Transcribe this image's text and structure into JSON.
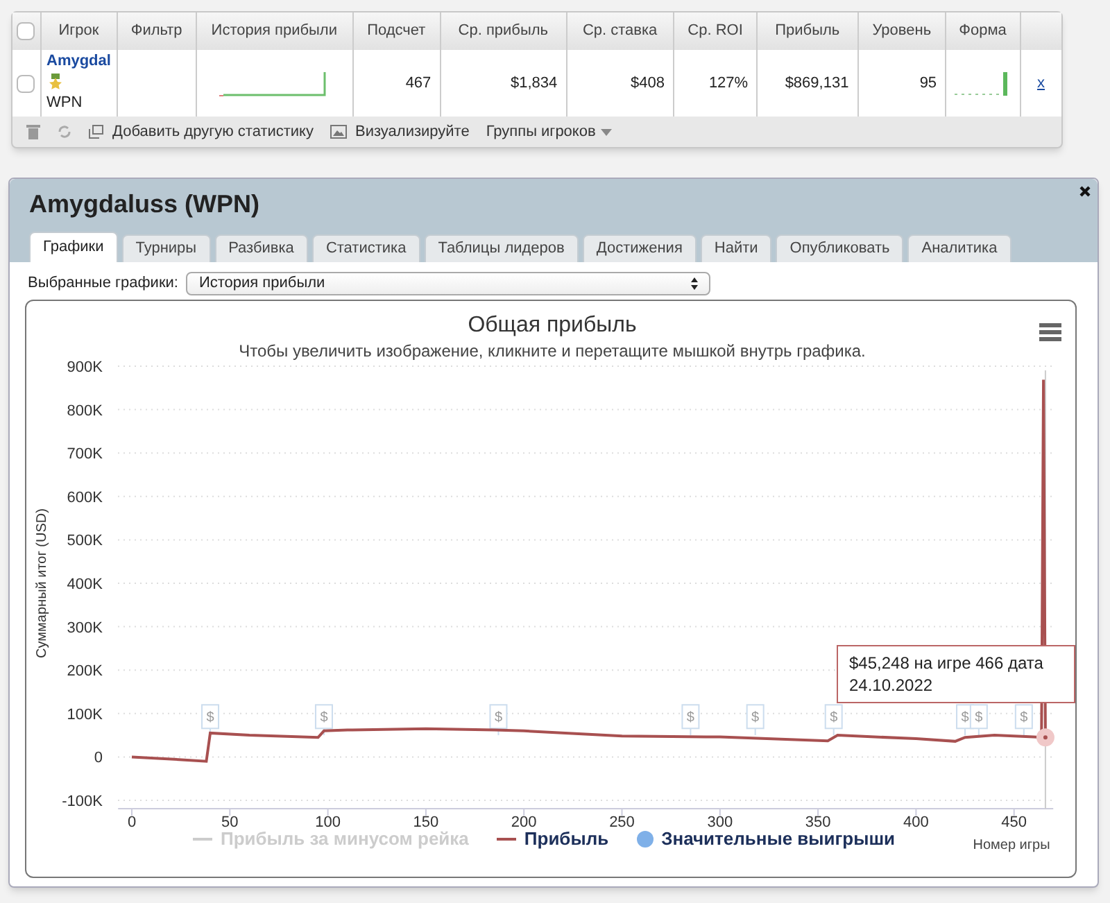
{
  "stats_table": {
    "select_all_checked": false,
    "columns": [
      "Игрок",
      "Фильтр",
      "История прибыли",
      "Подсчет",
      "Ср. прибыль",
      "Ср. ставка",
      "Ср. ROI",
      "Прибыль",
      "Уровень",
      "Форма"
    ],
    "rows": [
      {
        "checked": false,
        "player": "Amygdal",
        "network": "WPN",
        "count": "467",
        "avg_profit": "$1,834",
        "avg_stake": "$408",
        "avg_roi": "127%",
        "profit": "$869,131",
        "level": "95",
        "remove": "x"
      }
    ],
    "toolbar": [
      {
        "kind": "trash"
      },
      {
        "kind": "refresh"
      },
      {
        "kind": "add",
        "label": "Добавить другую статистику"
      },
      {
        "kind": "image",
        "label": "Визуализируйте"
      },
      {
        "kind": "dropdown",
        "label": "Группы игроков"
      }
    ]
  },
  "dialog": {
    "title": "Amygdaluss (WPN)",
    "tabs": [
      {
        "label": "Графики",
        "selected": true
      },
      {
        "label": "Турниры",
        "selected": false
      },
      {
        "label": "Разбивка",
        "selected": false
      },
      {
        "label": "Статистика",
        "selected": false
      },
      {
        "label": "Таблицы лидеров",
        "selected": false
      },
      {
        "label": "Достижения",
        "selected": false
      },
      {
        "label": "Найти",
        "selected": false
      },
      {
        "label": "Опубликовать",
        "selected": false
      },
      {
        "label": "Аналитика",
        "selected": false
      }
    ],
    "graph_select": {
      "label": "Выбранные графики:",
      "value": "История прибыли"
    },
    "chart_data": {
      "type": "line",
      "title": "Общая прибыль",
      "subtitle": "Чтобы увеличить изображение, кликните и перетащите мышкой внутрь графика.",
      "xlabel": "Номер игры",
      "ylabel": "Суммарный итог (USD)",
      "x": [
        0,
        20,
        38,
        40,
        60,
        95,
        98,
        110,
        150,
        185,
        200,
        250,
        300,
        355,
        360,
        400,
        420,
        425,
        440,
        460,
        464,
        465,
        466
      ],
      "series": [
        {
          "name": "Прибыль",
          "color": "#a85050",
          "values": [
            0,
            -5,
            -10,
            55,
            50,
            45,
            60,
            62,
            65,
            62,
            60,
            48,
            46,
            37,
            50,
            42,
            36,
            45,
            50,
            46,
            45,
            869,
            45
          ]
        }
      ],
      "ref_lines": [
        {
          "axis": "x",
          "value": 466,
          "color": "#cccccc"
        }
      ],
      "xlim": [
        -7,
        470
      ],
      "ylim": [
        -100,
        900
      ],
      "grid": true,
      "xticks": [
        0,
        50,
        100,
        150,
        200,
        250,
        300,
        350,
        400,
        450
      ],
      "yticks": [
        {
          "value": -100,
          "label": "-100K"
        },
        {
          "value": 0,
          "label": "0"
        },
        {
          "value": 100,
          "label": "100K"
        },
        {
          "value": 200,
          "label": "200K"
        },
        {
          "value": 300,
          "label": "300K"
        },
        {
          "value": 400,
          "label": "400K"
        },
        {
          "value": 500,
          "label": "500K"
        },
        {
          "value": 600,
          "label": "600K"
        },
        {
          "value": 700,
          "label": "700K"
        },
        {
          "value": 800,
          "label": "800K"
        },
        {
          "value": 900,
          "label": "900K"
        }
      ],
      "annotations": [
        {
          "x": 40,
          "text": "$"
        },
        {
          "x": 98,
          "text": "$"
        },
        {
          "x": 187,
          "text": "$"
        },
        {
          "x": 285,
          "text": "$"
        },
        {
          "x": 318,
          "text": "$"
        },
        {
          "x": 358,
          "text": "$"
        },
        {
          "x": 425,
          "text": "$"
        },
        {
          "x": 432,
          "text": "$"
        },
        {
          "x": 455,
          "text": "$"
        }
      ]
    },
    "legend": [
      {
        "label": "Прибыль за минусом рейка",
        "kind": "line",
        "visible": false,
        "color": "#cccccc"
      },
      {
        "kind": "series",
        "visible": true
      },
      {
        "label": "Значительные выигрыши",
        "kind": "dot",
        "visible": true,
        "color": "#7fb0e8"
      }
    ],
    "tooltip": {
      "text": "$45,248 на игре 466 дата 24.10.2022"
    }
  }
}
